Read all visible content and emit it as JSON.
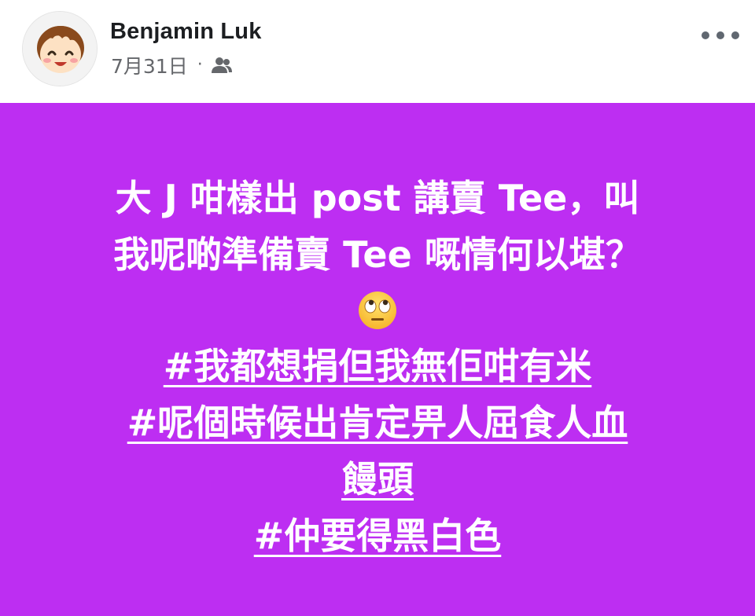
{
  "post": {
    "author": "Benjamin Luk",
    "date": "7月31日",
    "separator": "·",
    "audience_icon": "friends-icon",
    "more_icon": "more-dots-icon",
    "avatar": "cartoon-avatar"
  },
  "content": {
    "background_color": "#bd2ef2",
    "line1": "大 J 咁樣出 post 講賣 Tee，叫",
    "line2": "我呢啲準備賣 Tee 嘅情何以堪？",
    "emoji": "face-with-rolling-eyes",
    "hashtag1": "#我都想捐但我無佢咁有米",
    "hashtag2": "#呢個時候出肯定畀人屈食人血",
    "hashtag2_cont": "饅頭",
    "hashtag3": "#仲要得黑白色"
  }
}
